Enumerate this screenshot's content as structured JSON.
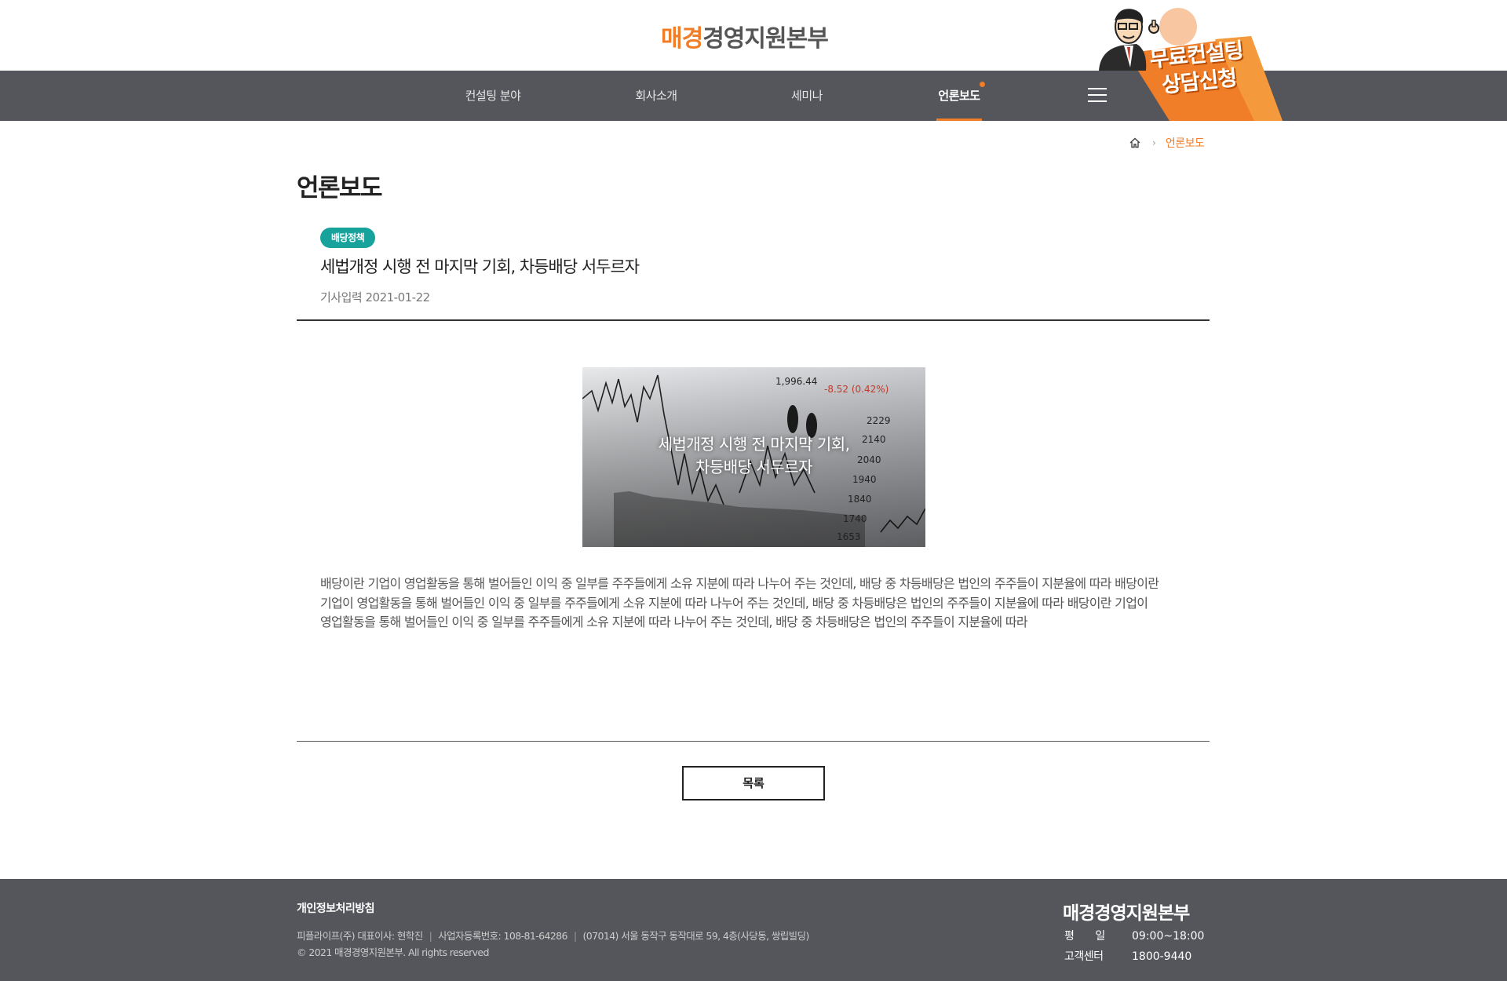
{
  "header": {
    "logo_accent": "매경",
    "logo_rest": "경영지원본부"
  },
  "nav": {
    "items": [
      {
        "label": "컨설팅 분야"
      },
      {
        "label": "회사소개"
      },
      {
        "label": "세미나"
      },
      {
        "label": "언론보도"
      }
    ],
    "active_index": 3,
    "menu_icon": "hamburger-icon"
  },
  "consult_banner": {
    "line1": "무료컨설팅",
    "line2": "상담신청"
  },
  "breadcrumb": {
    "home_icon": "home-icon",
    "separator_icon": "chevron-right-icon",
    "current": "언론보도"
  },
  "page": {
    "title": "언론보도"
  },
  "article": {
    "category": "배당정책",
    "title": "세법개정 시행 전 마지막 기회, 차등배당 서두르자",
    "date_label": "기사입력",
    "date": "2021-01-22",
    "image_caption_line1": "세법개정 시행 전 마지막 기회,",
    "image_caption_line2": "차등배당 서두르자",
    "image_numbers": [
      "1,996.44",
      "-8.52 (0.42%)",
      "2229",
      "2140",
      "2040",
      "1940",
      "1840",
      "1740",
      "1653"
    ],
    "body": "배당이란 기업이 영업활동을 통해 벌어들인 이익 중 일부를 주주들에게 소유 지분에 따라 나누어 주는 것인데, 배당 중 차등배당은 법인의 주주들이 지분율에 따라 배당이란 기업이 영업활동을 통해 벌어들인 이익 중 일부를 주주들에게 소유 지분에 따라 나누어 주는 것인데, 배당 중 차등배당은 법인의 주주들이 지분율에 따라 배당이란 기업이 영업활동을 통해 벌어들인 이익 중 일부를 주주들에게 소유 지분에 따라 나누어 주는 것인데, 배당 중 차등배당은 법인의 주주들이 지분율에 따라"
  },
  "list_button": "목록",
  "footer": {
    "privacy": "개인정보처리방침",
    "company": "피플라이프(주) 대표이사: 현학진",
    "registration": "사업자등록번호: 108-81-64286",
    "address": "(07014) 서울 동작구 동작대로 59, 4층(사당동, 쌍립빌딩)",
    "copyright": "© 2021 매경경영지원본부. All rights reserved",
    "logo": "매경경영지원본부",
    "hours_label": "평　　일",
    "hours_value": "09:00~18:00",
    "center_label": "고객센터",
    "center_value": "1800-9440"
  },
  "colors": {
    "accent": "#f07d28",
    "nav_bg": "#55565b",
    "badge": "#17a39c",
    "footer_bg": "#55565b"
  }
}
